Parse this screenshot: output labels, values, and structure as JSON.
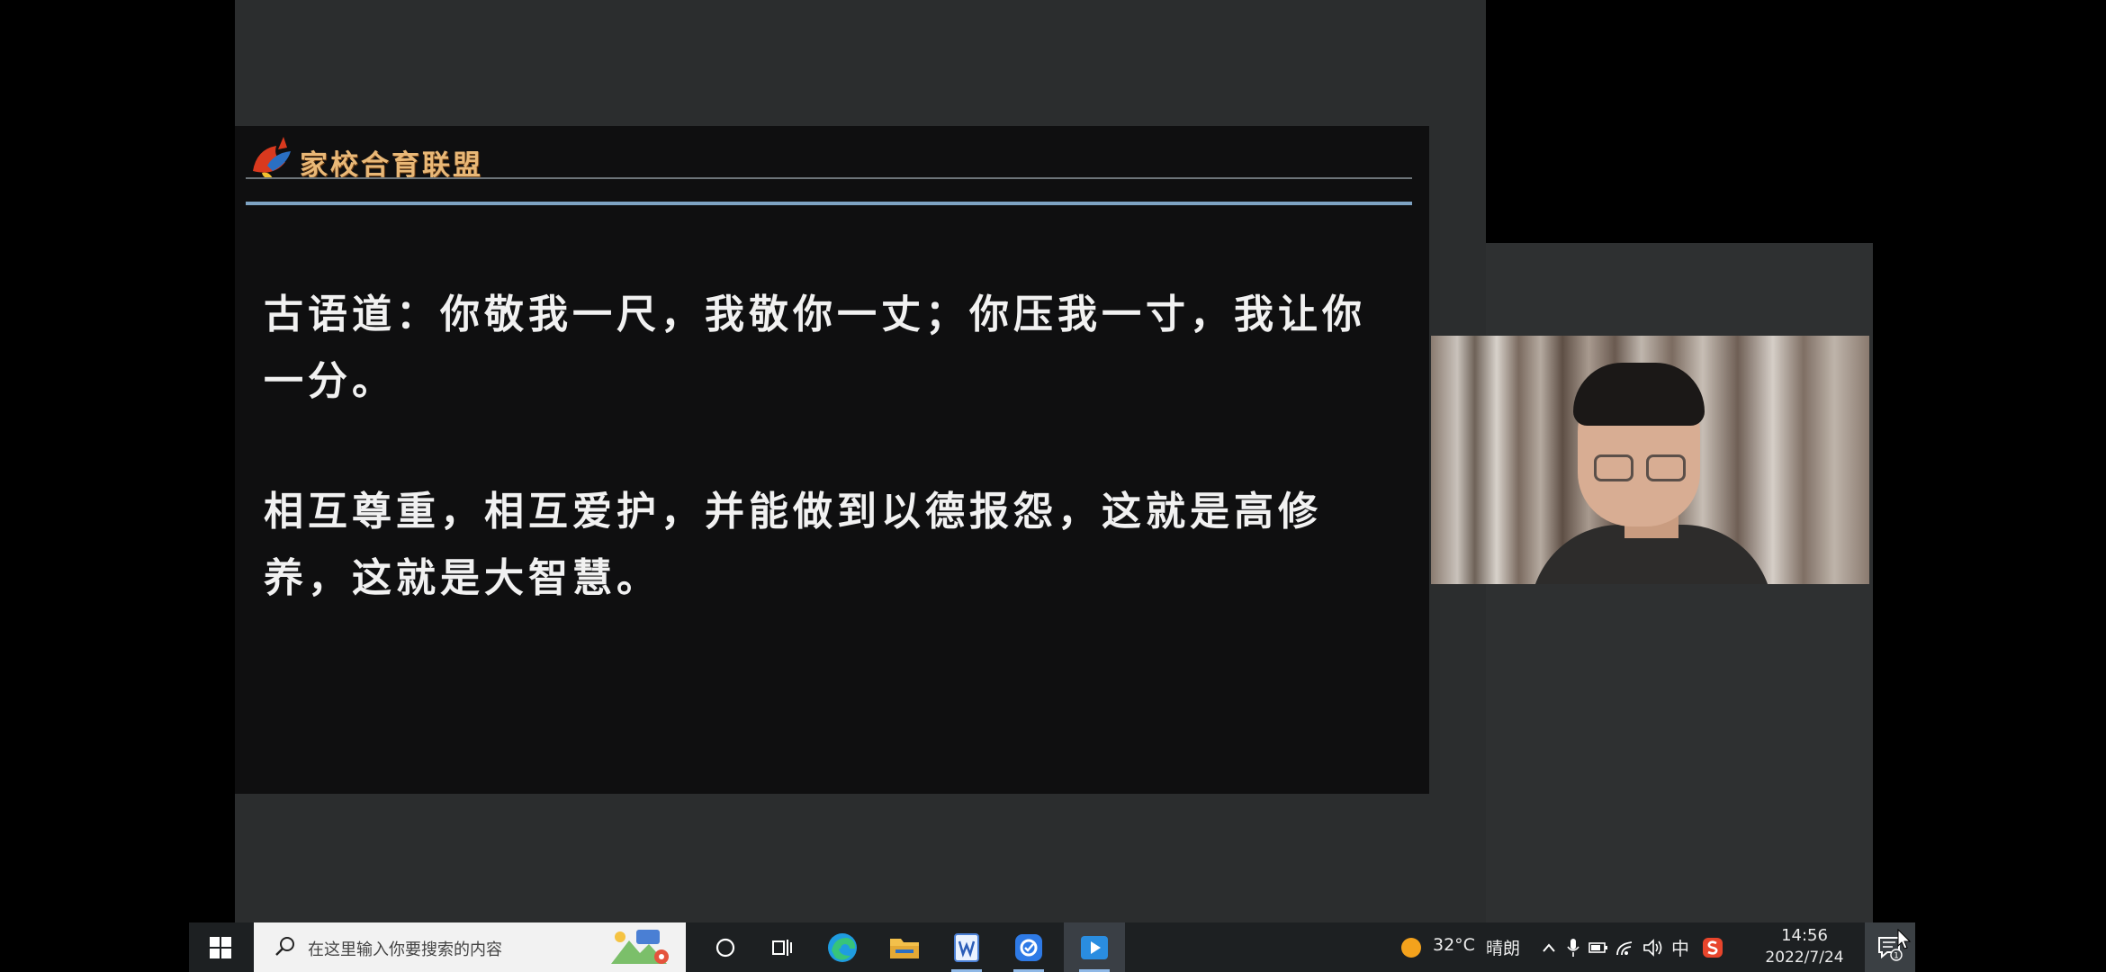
{
  "slide": {
    "brand": "家校合育联盟",
    "paragraph_1": "古语道：你敬我一尺，我敬你一丈；你压我一寸，我让你一分。",
    "paragraph_2": "相互尊重，相互爱护，并能做到以德报怨，这就是高修养，这就是大智慧。"
  },
  "taskbar": {
    "search_placeholder": "在这里输入你要搜索的内容",
    "apps": [
      "cortana-icon",
      "task-view-icon",
      "edge-icon",
      "file-explorer-icon",
      "wps-writer-icon",
      "meeting-app-icon",
      "media-player-icon"
    ],
    "weather_temp": "32°C",
    "weather_text": "晴朗",
    "ime": "中",
    "time": "14:56",
    "date": "2022/7/24",
    "notification_count": "1"
  },
  "colors": {
    "brand_text": "#e9b877",
    "slide_rule": "#7ea3c3",
    "taskbar": "#1d2022"
  }
}
